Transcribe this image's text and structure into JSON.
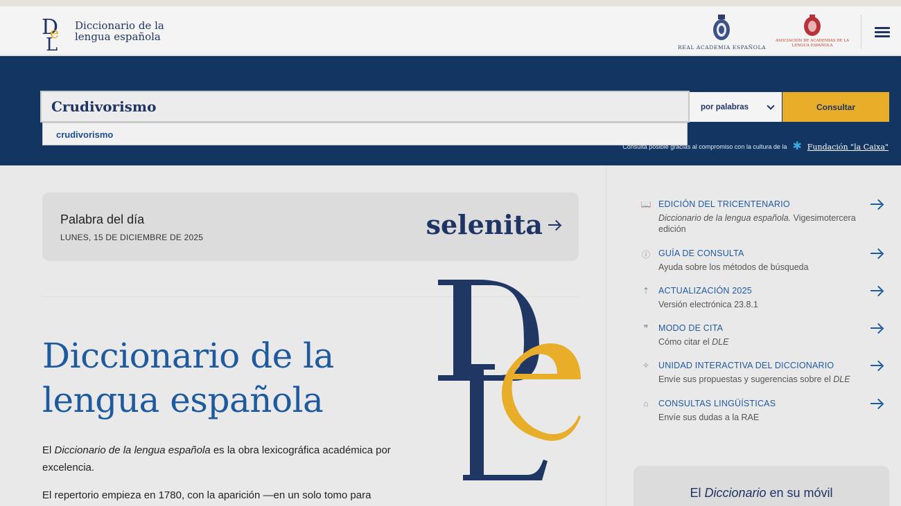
{
  "header": {
    "logo_line1": "Diccionario de la",
    "logo_line2": "lengua española",
    "rae_label": "REAL ACADEMIA ESPAÑOLA",
    "asale_line1": "ASOCIACIÓN DE ACADEMIAS DE LA",
    "asale_line2": "LENGUA ESPAÑOLA"
  },
  "search": {
    "query": "Crudivorismo",
    "suggestion": "crudivorismo",
    "mode": "por palabras",
    "button": "Consultar",
    "sponsor_text": "Consulta posible gracias al compromiso con la cultura de la",
    "sponsor_name": "Fundación \"la Caixa\""
  },
  "word_of_day": {
    "title": "Palabra del día",
    "date": "LUNES, 15 DE DICIEMBRE DE 2025",
    "word": "selenita"
  },
  "intro": {
    "title_line1": "Diccionario de la",
    "title_line2": "lengua española",
    "p1_prefix": "El ",
    "p1_em": "Diccionario de la lengua española",
    "p1_suffix": " es la obra lexicográfica académica por excelencia.",
    "p2": "El repertorio empieza en 1780, con la aparición —en un solo tomo para"
  },
  "sidebar": {
    "items": [
      {
        "title": "EDICIÓN DEL TRICENTENARIO",
        "desc_em": "Diccionario de la lengua española.",
        "desc": " Vigesimotercera edición",
        "icon": "book-icon"
      },
      {
        "title": "GUÍA DE CONSULTA",
        "desc": "Ayuda sobre los métodos de búsqueda",
        "icon": "help-icon"
      },
      {
        "title": "ACTUALIZACIÓN 2025",
        "desc": "Versión electrónica 23.8.1",
        "icon": "upload-icon"
      },
      {
        "title": "MODO DE CITA",
        "desc": "Cómo citar el ",
        "desc_em": "DLE",
        "icon": "quote-icon"
      },
      {
        "title": "UNIDAD INTERACTIVA DEL DICCIONARIO",
        "desc": "Envíe sus propuestas y sugerencias sobre el ",
        "desc_em": "DLE",
        "icon": "lightbulb-icon"
      },
      {
        "title": "CONSULTAS LINGÜÍSTICAS",
        "desc": "Envíe sus dudas a la RAE",
        "icon": "graduation-icon"
      }
    ]
  },
  "mobile": {
    "prefix": "El ",
    "em": "Diccionario",
    "suffix": " en su móvil"
  },
  "colors": {
    "navy": "#123562",
    "accent": "#e8ae2a",
    "link": "#1f5a9e"
  }
}
